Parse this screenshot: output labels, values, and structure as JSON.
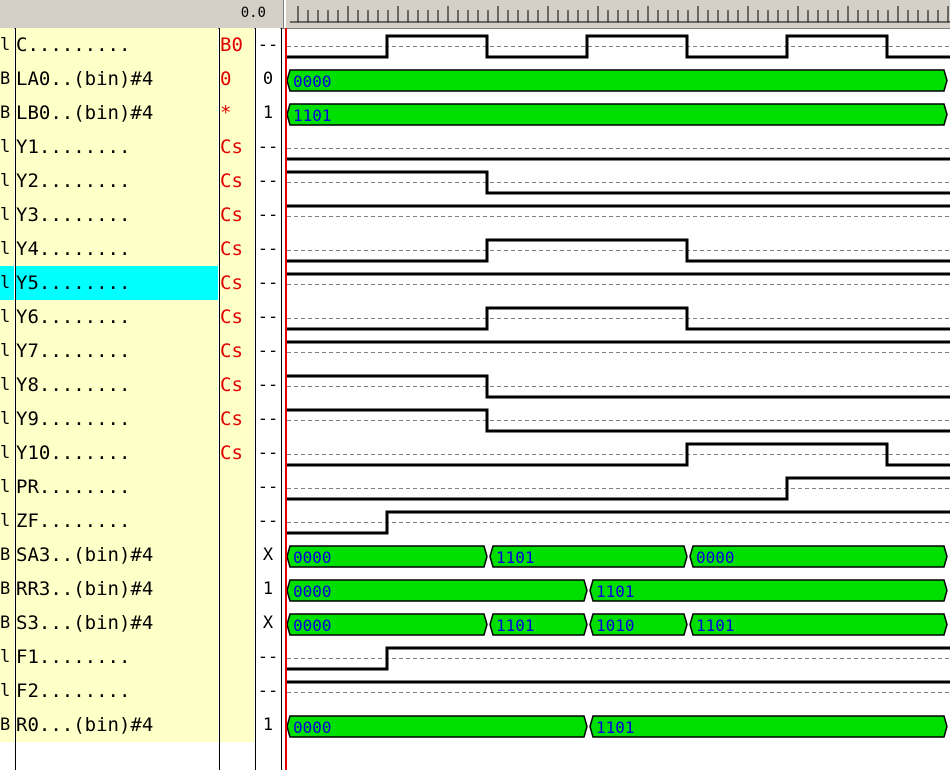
{
  "header": {
    "time": "0.0"
  },
  "rows": [
    {
      "type": "l",
      "name": "C.........",
      "value": "B0",
      "sym": "--",
      "wave": {
        "kind": "clock",
        "start": 0,
        "edges": [
          1,
          2,
          3,
          4,
          5,
          6
        ]
      }
    },
    {
      "type": "B",
      "name": "LA0..(bin)#4",
      "value": "0",
      "sym": "0",
      "wave": {
        "kind": "bus",
        "segs": [
          {
            "from": 0,
            "to": 6.6,
            "label": "0000"
          }
        ]
      }
    },
    {
      "type": "B",
      "name": "LB0..(bin)#4",
      "value": "*",
      "sym": "1",
      "wave": {
        "kind": "bus",
        "segs": [
          {
            "from": 0,
            "to": 6.6,
            "label": "1101"
          }
        ]
      }
    },
    {
      "type": "l",
      "name": "Y1........",
      "value": "Cs",
      "sym": "--",
      "wave": {
        "kind": "bit",
        "start": 0,
        "edges": []
      }
    },
    {
      "type": "l",
      "name": "Y2........",
      "value": "Cs",
      "sym": "--",
      "wave": {
        "kind": "bit",
        "start": 1,
        "edges": [
          2
        ]
      }
    },
    {
      "type": "l",
      "name": "Y3........",
      "value": "Cs",
      "sym": "--",
      "wave": {
        "kind": "bit",
        "start": 1,
        "edges": []
      }
    },
    {
      "type": "l",
      "name": "Y4........",
      "value": "Cs",
      "sym": "--",
      "wave": {
        "kind": "bit",
        "start": 0,
        "edges": [
          2,
          4
        ]
      }
    },
    {
      "type": "l",
      "name": "Y5........",
      "value": "Cs",
      "sym": "--",
      "selected": true,
      "wave": {
        "kind": "bit",
        "start": 1,
        "edges": []
      }
    },
    {
      "type": "l",
      "name": "Y6........",
      "value": "Cs",
      "sym": "--",
      "wave": {
        "kind": "bit",
        "start": 0,
        "edges": [
          2,
          4
        ]
      }
    },
    {
      "type": "l",
      "name": "Y7........",
      "value": "Cs",
      "sym": "--",
      "wave": {
        "kind": "bit",
        "start": 1,
        "edges": []
      }
    },
    {
      "type": "l",
      "name": "Y8........",
      "value": "Cs",
      "sym": "--",
      "wave": {
        "kind": "bit",
        "start": 1,
        "edges": [
          2
        ]
      }
    },
    {
      "type": "l",
      "name": "Y9........",
      "value": "Cs",
      "sym": "--",
      "wave": {
        "kind": "bit",
        "start": 1,
        "edges": [
          2
        ]
      }
    },
    {
      "type": "l",
      "name": "Y10.......",
      "value": "Cs",
      "sym": "--",
      "wave": {
        "kind": "bit",
        "start": 0,
        "edges": [
          4,
          6
        ]
      }
    },
    {
      "type": "l",
      "name": "PR........",
      "value": "",
      "sym": "--",
      "wave": {
        "kind": "bit",
        "start": 0,
        "edges": [
          5
        ]
      }
    },
    {
      "type": "l",
      "name": "ZF........",
      "value": "",
      "sym": "--",
      "wave": {
        "kind": "bit",
        "start": 0,
        "edges": [
          1
        ]
      }
    },
    {
      "type": "B",
      "name": "SA3..(bin)#4",
      "value": "",
      "sym": "X",
      "wave": {
        "kind": "bus",
        "segs": [
          {
            "from": 0,
            "to": 2,
            "label": "0000"
          },
          {
            "from": 2,
            "to": 4,
            "label": "1101"
          },
          {
            "from": 4,
            "to": 6.6,
            "label": "0000"
          }
        ]
      }
    },
    {
      "type": "B",
      "name": "RR3..(bin)#4",
      "value": "",
      "sym": "1",
      "wave": {
        "kind": "bus",
        "segs": [
          {
            "from": 0,
            "to": 3,
            "label": "0000"
          },
          {
            "from": 3,
            "to": 6.6,
            "label": "1101"
          }
        ]
      }
    },
    {
      "type": "B",
      "name": "S3...(bin)#4",
      "value": "",
      "sym": "X",
      "wave": {
        "kind": "bus",
        "segs": [
          {
            "from": 0,
            "to": 2,
            "label": "0000"
          },
          {
            "from": 2,
            "to": 3,
            "label": "1101"
          },
          {
            "from": 3,
            "to": 4,
            "label": "1010"
          },
          {
            "from": 4,
            "to": 6.6,
            "label": "1101"
          }
        ]
      }
    },
    {
      "type": "l",
      "name": "F1........",
      "value": "",
      "sym": "--",
      "wave": {
        "kind": "bit",
        "start": 0,
        "edges": [
          1
        ]
      }
    },
    {
      "type": "l",
      "name": "F2........",
      "value": "",
      "sym": "--",
      "wave": {
        "kind": "bit",
        "start": 1,
        "edges": []
      }
    },
    {
      "type": "B",
      "name": "R0...(bin)#4",
      "value": "",
      "sym": "1",
      "wave": {
        "kind": "bus",
        "segs": [
          {
            "from": 0,
            "to": 3,
            "label": "0000"
          },
          {
            "from": 3,
            "to": 6.6,
            "label": "1101"
          }
        ]
      }
    }
  ],
  "colors": {
    "panel": "#ffffc8",
    "selected": "#00ffff",
    "bus_fill": "#00e000",
    "bus_text": "#0000e0",
    "value_text": "#e00000",
    "cursor": "#e00000"
  }
}
